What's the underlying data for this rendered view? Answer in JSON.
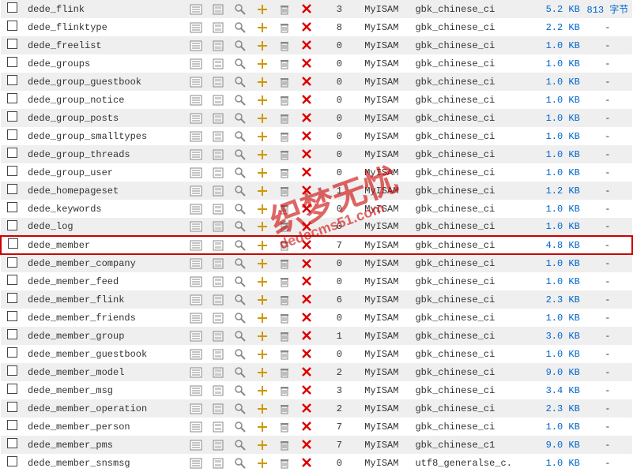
{
  "engine": "MyISAM",
  "collation": "gbk_chinese_ci",
  "collation_utf8": "utf8_generalse_c.",
  "dash": "-",
  "highlight_row": 13,
  "watermark": {
    "main": "织梦无忧",
    "sub": "dedecms51.com"
  },
  "rows": [
    {
      "name": "dede_flink",
      "rec": 3,
      "size": "5.2 KB",
      "ext": "813 字节",
      "coll": "gbk_chinese_ci"
    },
    {
      "name": "dede_flinktype",
      "rec": 8,
      "size": "2.2 KB",
      "ext": "-",
      "coll": "gbk_chinese_ci"
    },
    {
      "name": "dede_freelist",
      "rec": 0,
      "size": "1.0 KB",
      "ext": "-",
      "coll": "gbk_chinese_ci"
    },
    {
      "name": "dede_groups",
      "rec": 0,
      "size": "1.0 KB",
      "ext": "-",
      "coll": "gbk_chinese_ci"
    },
    {
      "name": "dede_group_guestbook",
      "rec": 0,
      "size": "1.0 KB",
      "ext": "-",
      "coll": "gbk_chinese_ci"
    },
    {
      "name": "dede_group_notice",
      "rec": 0,
      "size": "1.0 KB",
      "ext": "-",
      "coll": "gbk_chinese_ci"
    },
    {
      "name": "dede_group_posts",
      "rec": 0,
      "size": "1.0 KB",
      "ext": "-",
      "coll": "gbk_chinese_ci"
    },
    {
      "name": "dede_group_smalltypes",
      "rec": 0,
      "size": "1.0 KB",
      "ext": "-",
      "coll": "gbk_chinese_ci"
    },
    {
      "name": "dede_group_threads",
      "rec": 0,
      "size": "1.0 KB",
      "ext": "-",
      "coll": "gbk_chinese_ci"
    },
    {
      "name": "dede_group_user",
      "rec": 0,
      "size": "1.0 KB",
      "ext": "-",
      "coll": "gbk_chinese_ci"
    },
    {
      "name": "dede_homepageset",
      "rec": 1,
      "size": "1.2 KB",
      "ext": "-",
      "coll": "gbk_chinese_ci"
    },
    {
      "name": "dede_keywords",
      "rec": 0,
      "size": "1.0 KB",
      "ext": "-",
      "coll": "gbk_chinese_ci"
    },
    {
      "name": "dede_log",
      "rec": 0,
      "size": "1.0 KB",
      "ext": "-",
      "coll": "gbk_chinese_ci"
    },
    {
      "name": "dede_member",
      "rec": 7,
      "size": "4.8 KB",
      "ext": "-",
      "coll": "gbk_chinese_ci"
    },
    {
      "name": "dede_member_company",
      "rec": 0,
      "size": "1.0 KB",
      "ext": "-",
      "coll": "gbk_chinese_ci"
    },
    {
      "name": "dede_member_feed",
      "rec": 0,
      "size": "1.0 KB",
      "ext": "-",
      "coll": "gbk_chinese_ci"
    },
    {
      "name": "dede_member_flink",
      "rec": 6,
      "size": "2.3 KB",
      "ext": "-",
      "coll": "gbk_chinese_ci"
    },
    {
      "name": "dede_member_friends",
      "rec": 0,
      "size": "1.0 KB",
      "ext": "-",
      "coll": "gbk_chinese_ci"
    },
    {
      "name": "dede_member_group",
      "rec": 1,
      "size": "3.0 KB",
      "ext": "-",
      "coll": "gbk_chinese_ci"
    },
    {
      "name": "dede_member_guestbook",
      "rec": 0,
      "size": "1.0 KB",
      "ext": "-",
      "coll": "gbk_chinese_ci"
    },
    {
      "name": "dede_member_model",
      "rec": 2,
      "size": "9.0 KB",
      "ext": "-",
      "coll": "gbk_chinese_ci"
    },
    {
      "name": "dede_member_msg",
      "rec": 3,
      "size": "3.4 KB",
      "ext": "-",
      "coll": "gbk_chinese_ci"
    },
    {
      "name": "dede_member_operation",
      "rec": 2,
      "size": "2.3 KB",
      "ext": "-",
      "coll": "gbk_chinese_ci"
    },
    {
      "name": "dede_member_person",
      "rec": 7,
      "size": "1.0 KB",
      "ext": "-",
      "coll": "gbk_chinese_ci"
    },
    {
      "name": "dede_member_pms",
      "rec": 7,
      "size": "9.0 KB",
      "ext": "-",
      "coll": "gbk_chinese_c1"
    },
    {
      "name": "dede_member_snsmsg",
      "rec": 0,
      "size": "1.0 KB",
      "ext": "-",
      "coll": "utf8_generalse_c."
    }
  ]
}
